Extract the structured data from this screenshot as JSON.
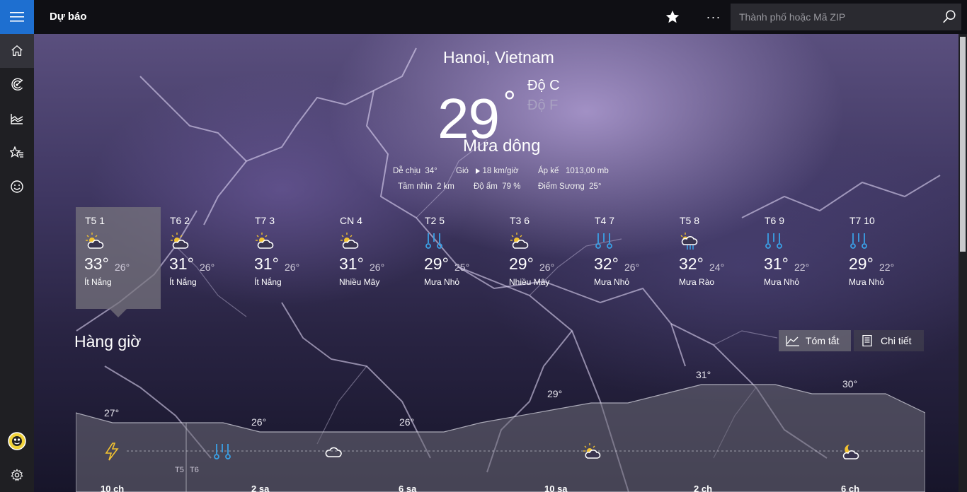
{
  "app": {
    "title": "Dự báo"
  },
  "search": {
    "placeholder": "Thành phố hoặc Mã ZIP"
  },
  "sidebar": {
    "items": [
      "home-icon",
      "radar-icon",
      "historical-chart-icon",
      "favorites-icon",
      "smiley-icon"
    ],
    "bottom": [
      "user-avatar",
      "settings-icon"
    ]
  },
  "current": {
    "city": "Hanoi, Vietnam",
    "temp": "29",
    "unit_c": "Độ C",
    "unit_f": "Độ F",
    "condition": "Mưa dông",
    "feels_label": "Dễ chịu",
    "feels_value": "34°",
    "wind_label": "Gió",
    "wind_value": "18 km/giờ",
    "pressure_label": "Áp kế",
    "pressure_value": "1013,00 mb",
    "visibility_label": "Tầm nhìn",
    "visibility_value": "2 km",
    "humidity_label": "Độ ẩm",
    "humidity_value": "79 %",
    "dewpoint_label": "Điểm Sương",
    "dewpoint_value": "25°"
  },
  "daily": [
    {
      "label": "T5 1",
      "icon": "partly-sunny-icon",
      "hi": "33°",
      "lo": "26°",
      "desc": "Ít Nắng"
    },
    {
      "label": "T6 2",
      "icon": "partly-sunny-icon",
      "hi": "31°",
      "lo": "26°",
      "desc": "Ít Nắng"
    },
    {
      "label": "T7 3",
      "icon": "partly-sunny-icon",
      "hi": "31°",
      "lo": "26°",
      "desc": "Ít Nắng"
    },
    {
      "label": "CN 4",
      "icon": "partly-sunny-icon",
      "hi": "31°",
      "lo": "26°",
      "desc": "Nhiều Mây"
    },
    {
      "label": "T2 5",
      "icon": "light-rain-icon",
      "hi": "29°",
      "lo": "25°",
      "desc": "Mưa Nhỏ"
    },
    {
      "label": "T3 6",
      "icon": "partly-sunny-icon",
      "hi": "29°",
      "lo": "26°",
      "desc": "Nhiều Mây"
    },
    {
      "label": "T4 7",
      "icon": "light-rain-icon",
      "hi": "32°",
      "lo": "26°",
      "desc": "Mưa Nhỏ"
    },
    {
      "label": "T5 8",
      "icon": "showers-icon",
      "hi": "32°",
      "lo": "24°",
      "desc": "Mưa Rào"
    },
    {
      "label": "T6 9",
      "icon": "light-rain-icon",
      "hi": "31°",
      "lo": "22°",
      "desc": "Mưa Nhỏ"
    },
    {
      "label": "T7 10",
      "icon": "light-rain-icon",
      "hi": "29°",
      "lo": "22°",
      "desc": "Mưa Nhỏ"
    }
  ],
  "hourly": {
    "title": "Hàng giờ",
    "summary_label": "Tóm tắt",
    "detail_label": "Chi tiết",
    "temps": [
      "27°",
      "26°",
      "26°",
      "29°",
      "31°",
      "30°"
    ],
    "times": [
      "10 ch",
      "2 sa",
      "6 sa",
      "10 sa",
      "2 ch",
      "6 ch"
    ],
    "day_break": [
      "T5",
      "T6"
    ],
    "icons": [
      "thunderstorm-icon",
      "light-rain-icon",
      "cloudy-icon",
      "partly-sunny-icon",
      "partly-cloudy-night-icon"
    ]
  },
  "colors": {
    "accent": "#1e6fd0",
    "rain": "#3aa0e6",
    "sun": "#f2c230"
  }
}
